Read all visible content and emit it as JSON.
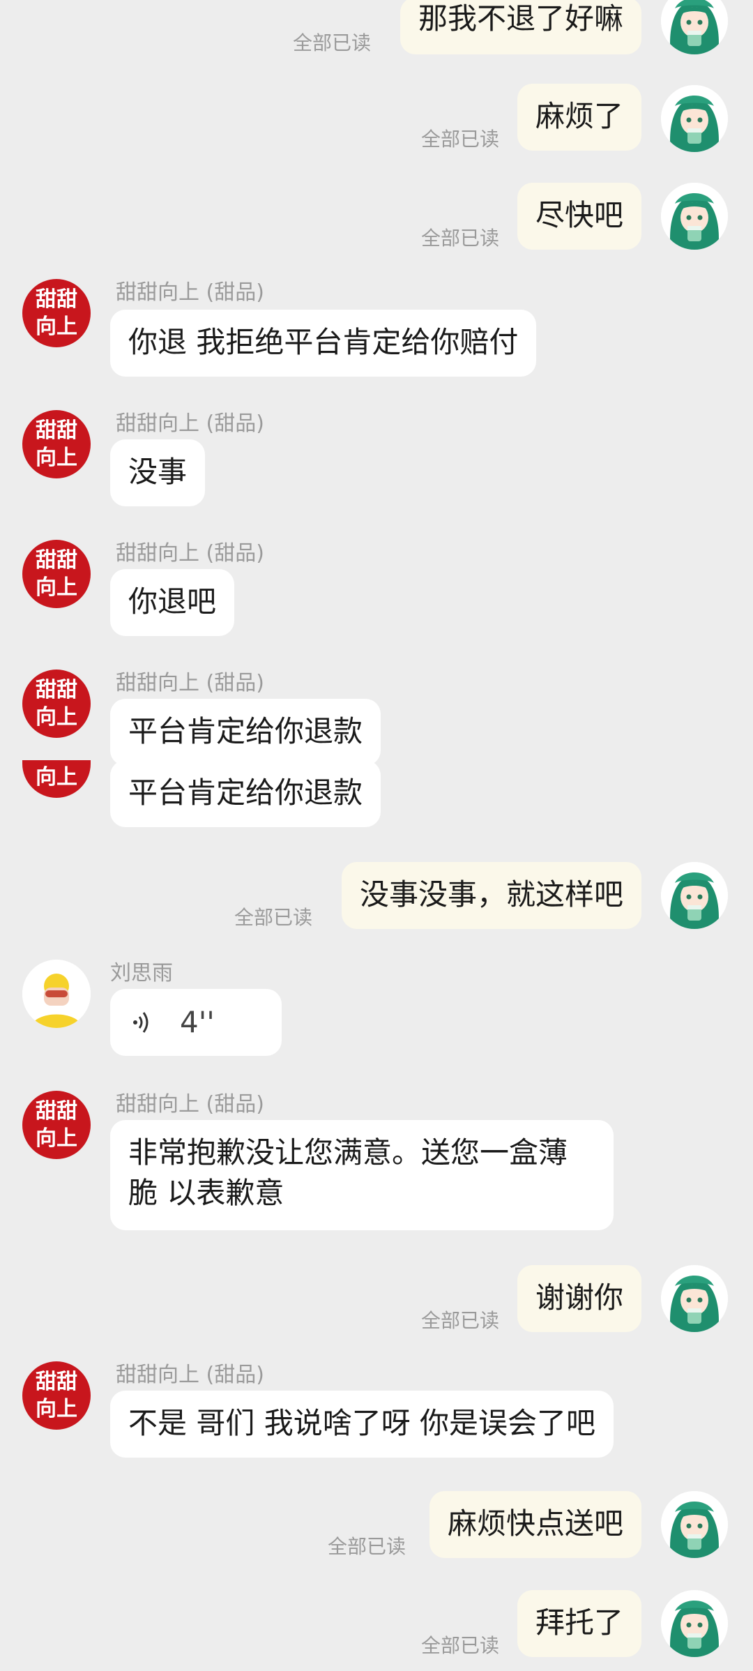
{
  "colors": {
    "background": "#ededed",
    "outgoing_bubble": "#fbf8ea",
    "incoming_bubble": "#ffffff",
    "shop_avatar": "#c8161d",
    "meta_text": "#9a9a9a"
  },
  "shop_avatar_text": [
    "甜甜",
    "向上"
  ],
  "shop_name": "甜甜向上 (甜品)",
  "read_status": "全部已读",
  "messages": [
    {
      "text": "那我不退了好嘛",
      "dir": "out"
    },
    {
      "text": "麻烦了",
      "dir": "out"
    },
    {
      "text": "尽快吧",
      "dir": "out"
    },
    {
      "text": "你退 我拒绝平台肯定给你赔付",
      "dir": "in"
    },
    {
      "text": "没事",
      "dir": "in"
    },
    {
      "text": "你退吧",
      "dir": "in"
    },
    {
      "text": "平台肯定给你退款",
      "dir": "in"
    },
    {
      "text": "平台肯定给你退款",
      "dir": "in"
    },
    {
      "text": "没事没事，就这样吧",
      "dir": "out"
    },
    {
      "sender": "刘思雨",
      "type": "voice",
      "duration": "4''",
      "dir": "in"
    },
    {
      "text": "非常抱歉没让您满意。送您一盒薄脆 以表歉意",
      "dir": "in"
    },
    {
      "text": "谢谢你",
      "dir": "out"
    },
    {
      "text": "不是 哥们 我说啥了呀 你是误会了吧",
      "dir": "in"
    },
    {
      "text": "麻烦快点送吧",
      "dir": "out"
    },
    {
      "text": "拜托了",
      "dir": "out"
    }
  ]
}
